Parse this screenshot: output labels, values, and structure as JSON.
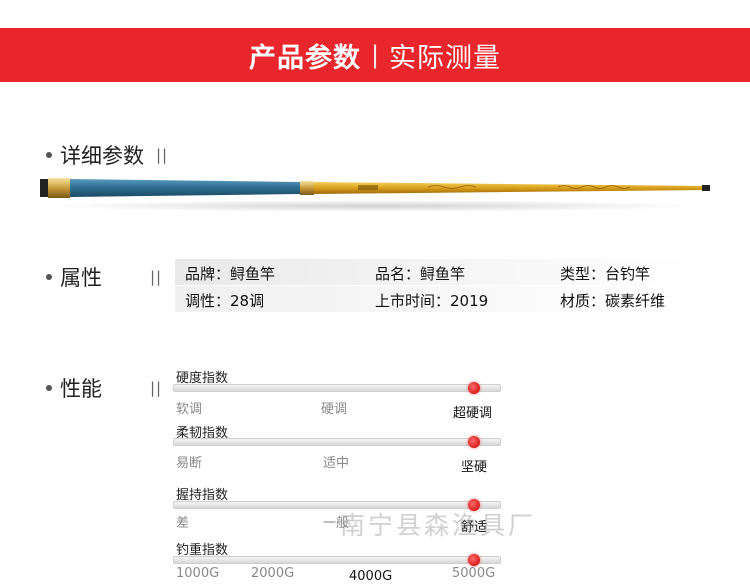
{
  "banner": {
    "title": "产品参数",
    "separator": "|",
    "subtitle": "实际测量"
  },
  "details": {
    "heading": "详细参数",
    "bars": "||"
  },
  "attributes": {
    "heading": "属性",
    "bars": "||",
    "rows": [
      [
        "品牌：鲟鱼竿",
        "品名：鲟鱼竿",
        "类型：台钓竿"
      ],
      [
        "调性：28调",
        "上市时间：2019",
        "材质：碳素纤维"
      ]
    ]
  },
  "performance": {
    "heading": "性能",
    "bars": "||",
    "metrics": [
      {
        "label": "硬度指数",
        "ticks": [
          "软调",
          "硬调",
          "超硬调"
        ],
        "selected": 2,
        "level": 0.92
      },
      {
        "label": "柔韧指数",
        "ticks": [
          "易断",
          "适中",
          "坚硬"
        ],
        "selected": 2,
        "level": 0.92
      },
      {
        "label": "握持指数",
        "ticks": [
          "差",
          "一般",
          "舒适"
        ],
        "selected": 2,
        "level": 0.92
      },
      {
        "label": "钓重指数",
        "ticks": [
          "1000G",
          "2000G",
          "4000G",
          "5000G"
        ],
        "selected": 2,
        "level": 0.92
      }
    ]
  },
  "watermark": "南宁县森渔具厂",
  "colors": {
    "brand_red": "#e8262b",
    "knob_red": "#e02020",
    "rod_blue": "#2e6f92",
    "rod_gold": "#d9a01a"
  }
}
